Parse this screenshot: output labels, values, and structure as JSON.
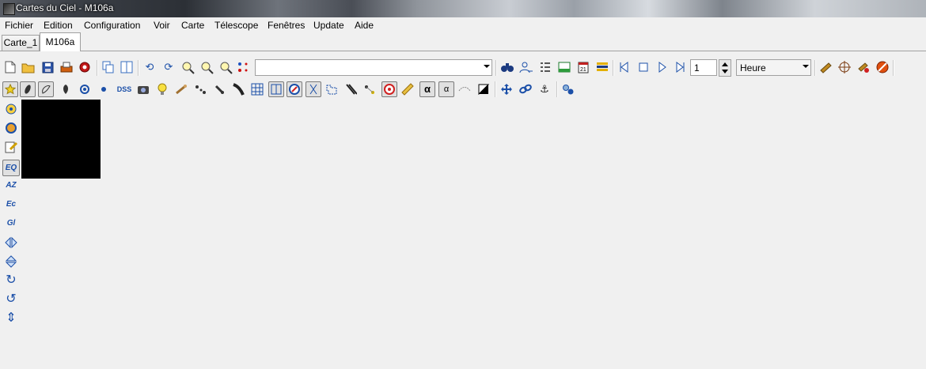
{
  "window": {
    "title": "Cartes du Ciel - M106a"
  },
  "menu": [
    "Fichier",
    "Edition",
    "Configuration",
    "Voir",
    "Carte",
    "Télescope",
    "Fenêtres",
    "Update",
    "Aide"
  ],
  "tabs": [
    "Carte_1",
    "M106a"
  ],
  "active_tab": "M106a",
  "toolbar1": {
    "search_value": "",
    "step_value": "1",
    "time_unit": "Heure"
  },
  "toolbar2": {
    "dss_label": "DSS",
    "alpha_label": "α",
    "alpha_cursor_label": "α"
  },
  "left_toolbar": {
    "eq_label": "EQ",
    "az_label": "AZ",
    "ec_label": "Ec",
    "gl_label": "Gl"
  },
  "colors": {
    "sky_background": "#000000",
    "icon_blue": "#1b4fa8",
    "window_bg": "#f0f0f0"
  }
}
